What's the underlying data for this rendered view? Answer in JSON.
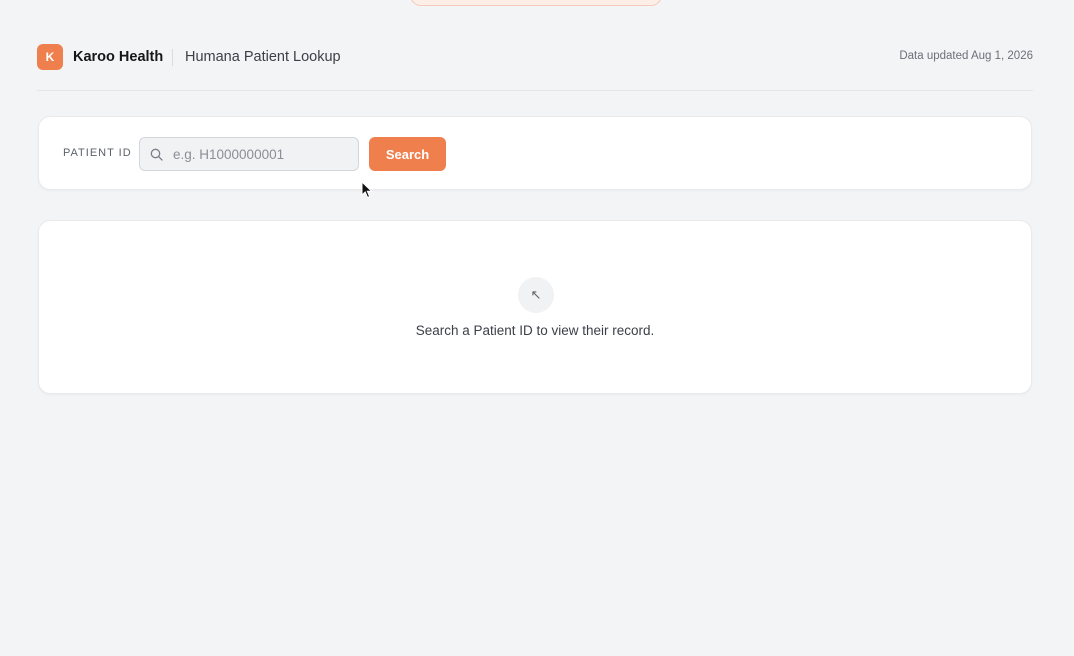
{
  "colors": {
    "accent": "#ef7f4d",
    "background": "#f3f4f6",
    "card": "#ffffff"
  },
  "header": {
    "logo_letter": "K",
    "brand": "Karoo Health",
    "title": "Humana Patient Lookup",
    "updated": "Data updated Aug 1, 2026"
  },
  "search": {
    "label": "PATIENT ID",
    "placeholder": "e.g. H1000000001",
    "value": "",
    "icon": "search-icon",
    "button_label": "Search"
  },
  "empty_state": {
    "icon": "arrow-up-left-icon",
    "icon_glyph": "↖",
    "message": "Search a Patient ID to view their record."
  }
}
